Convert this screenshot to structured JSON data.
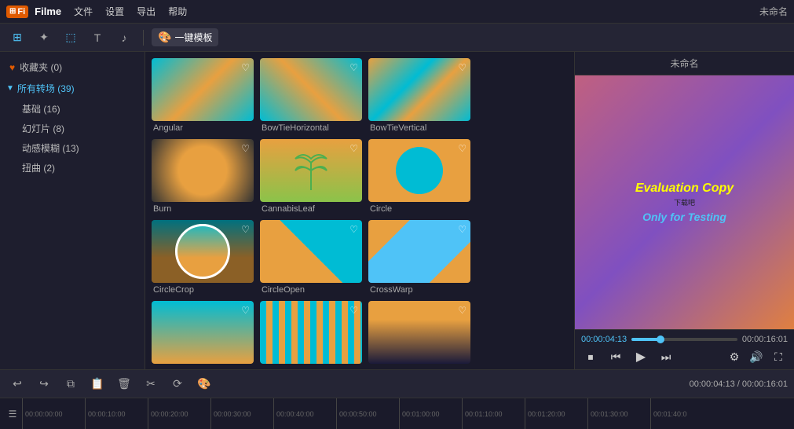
{
  "titlebar": {
    "logo": "Fi",
    "appname": "Filme",
    "menus": [
      "文件",
      "设置",
      "导出",
      "帮助"
    ],
    "window_title": "未命名"
  },
  "toolbar": {
    "icons": [
      "⊞",
      "✦",
      "⬚",
      "T",
      "♪"
    ],
    "one_key_label": "一键模板"
  },
  "sidebar": {
    "favorites": "收藏夹 (0)",
    "all_transitions": "所有转场 (39)",
    "basic": "基础 (16)",
    "slideshow": "幻灯片 (8)",
    "dynamic": "动感模糊 (13)",
    "distort": "扭曲 (2)"
  },
  "cards": [
    {
      "id": "angular",
      "label": "Angular",
      "thumb": "angular"
    },
    {
      "id": "bowtie-h",
      "label": "BowTieHorizontal",
      "thumb": "bowtie-h"
    },
    {
      "id": "bowtie-v",
      "label": "BowTieVertical",
      "thumb": "bowtie-v"
    },
    {
      "id": "burn",
      "label": "Burn",
      "thumb": "burn"
    },
    {
      "id": "cannabis",
      "label": "CannabisLeaf",
      "thumb": "cannabis"
    },
    {
      "id": "circle",
      "label": "Circle",
      "thumb": "circle"
    },
    {
      "id": "circlecrop",
      "label": "CircleCrop",
      "thumb": "circlecrop"
    },
    {
      "id": "circleopen",
      "label": "CircleOpen",
      "thumb": "circleopen"
    },
    {
      "id": "crosswarp",
      "label": "CrossWarp",
      "thumb": "crosswarp"
    },
    {
      "id": "more1",
      "label": "",
      "thumb": "more"
    },
    {
      "id": "more2",
      "label": "",
      "thumb": "more2"
    },
    {
      "id": "more3",
      "label": "",
      "thumb": "more3"
    }
  ],
  "preview": {
    "title": "未命名",
    "eval_line1": "Evaluation Copy",
    "eval_line2": "下载吧",
    "eval_line3": "Only for Testing",
    "time_current": "00:00:04:13",
    "time_total": "00:00:16:01",
    "progress_pct": 27
  },
  "bottom_toolbar": {
    "time_display": "00:00:04:13 / 00:00:16:01"
  },
  "timeline": {
    "marks": [
      "00:00:00:00",
      "00:00:10:00",
      "00:00:20:00",
      "00:00:30:00",
      "00:00:40:00",
      "00:00:50:00",
      "00:01:00:00",
      "00:01:10:00",
      "00:01:20:00",
      "00:01:30:00",
      "00:01:40:0"
    ]
  }
}
